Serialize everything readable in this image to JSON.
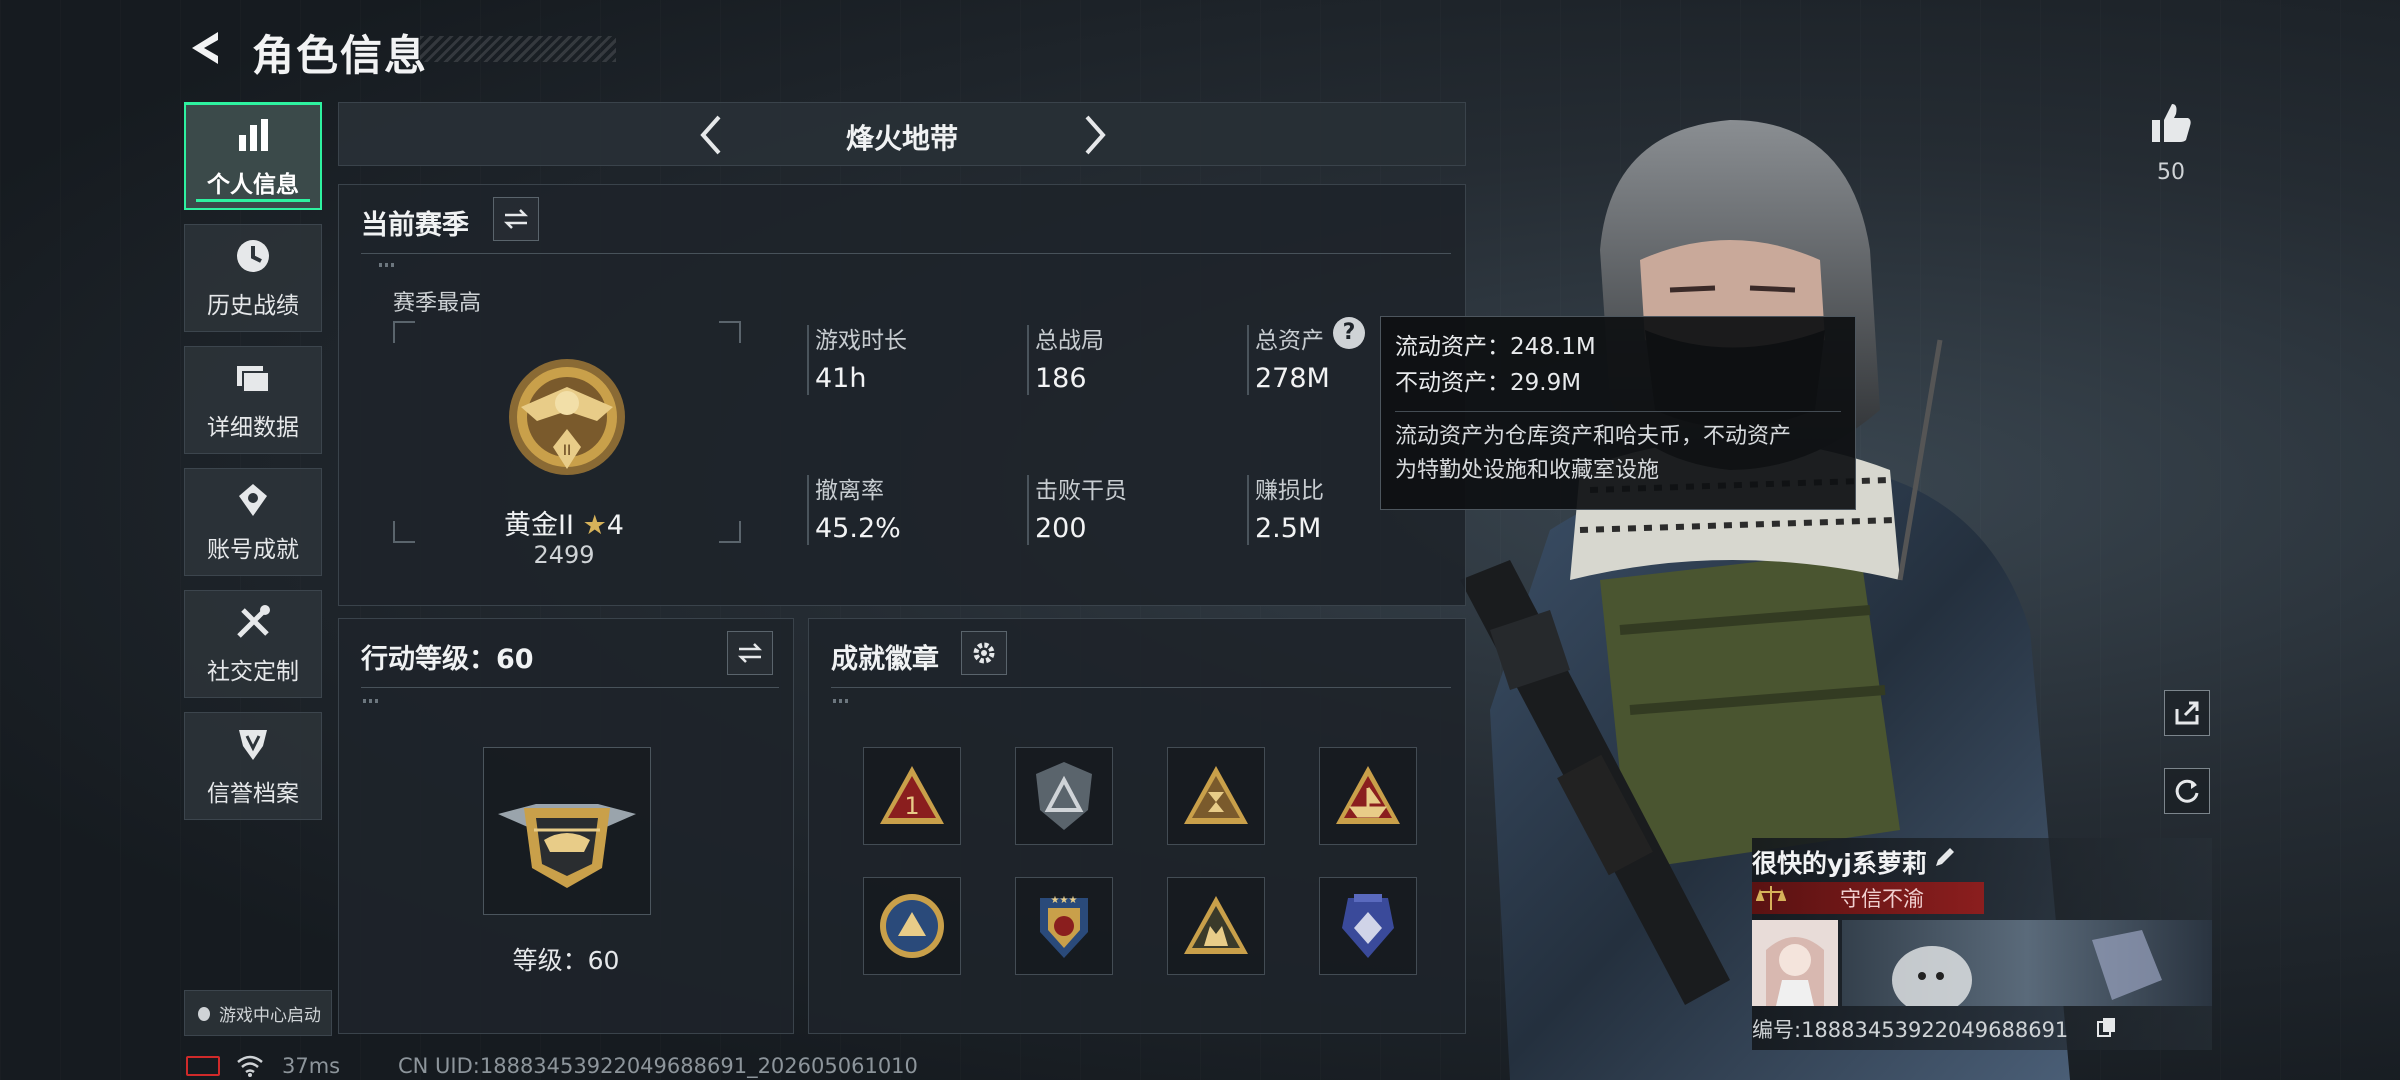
{
  "header": {
    "title": "角色信息"
  },
  "sidebar": {
    "items": [
      {
        "label": "个人信息",
        "icon": "bar-chart-icon",
        "active": true
      },
      {
        "label": "历史战绩",
        "icon": "clock-icon"
      },
      {
        "label": "详细数据",
        "icon": "folders-icon"
      },
      {
        "label": "账号成就",
        "icon": "achievement-icon"
      },
      {
        "label": "社交定制",
        "icon": "tools-icon"
      },
      {
        "label": "信誉档案",
        "icon": "shield-icon"
      }
    ],
    "game_center": "游戏中心启动"
  },
  "mode": {
    "name": "烽火地带"
  },
  "season": {
    "title": "当前赛季",
    "peak_label": "赛季最高",
    "rank_name": "黄金II",
    "rank_stars": "4",
    "rank_score": "2499",
    "stats": [
      {
        "label": "游戏时长",
        "value": "41h"
      },
      {
        "label": "总战局",
        "value": "186"
      },
      {
        "label": "总资产",
        "value": "278M"
      },
      {
        "label": "撤离率",
        "value": "45.2%"
      },
      {
        "label": "击败干员",
        "value": "200"
      },
      {
        "label": "赚损比",
        "value": "2.5M"
      }
    ]
  },
  "tooltip": {
    "liquid": "流动资产：248.1M",
    "fixed": "不动资产：29.9M",
    "desc_line1": "流动资产为仓库资产和哈夫币，不动资产",
    "desc_line2": "为特勤处设施和收藏室设施"
  },
  "action_level": {
    "title": "行动等级：60",
    "level_text": "等级：60"
  },
  "achievements": {
    "title": "成就徽章",
    "count": 8
  },
  "likes": {
    "count": "50"
  },
  "profile": {
    "name": "很快的yj系萝莉",
    "tag": "守信不渝",
    "id_text": "编号:18883453922049688691"
  },
  "footer": {
    "ping": "37ms",
    "uid": "CN UID:18883453922049688691_202605061010"
  },
  "colors": {
    "accent": "#2ef2a0",
    "tag_red": "#8b1e1e",
    "gold": "#c9a04a"
  }
}
